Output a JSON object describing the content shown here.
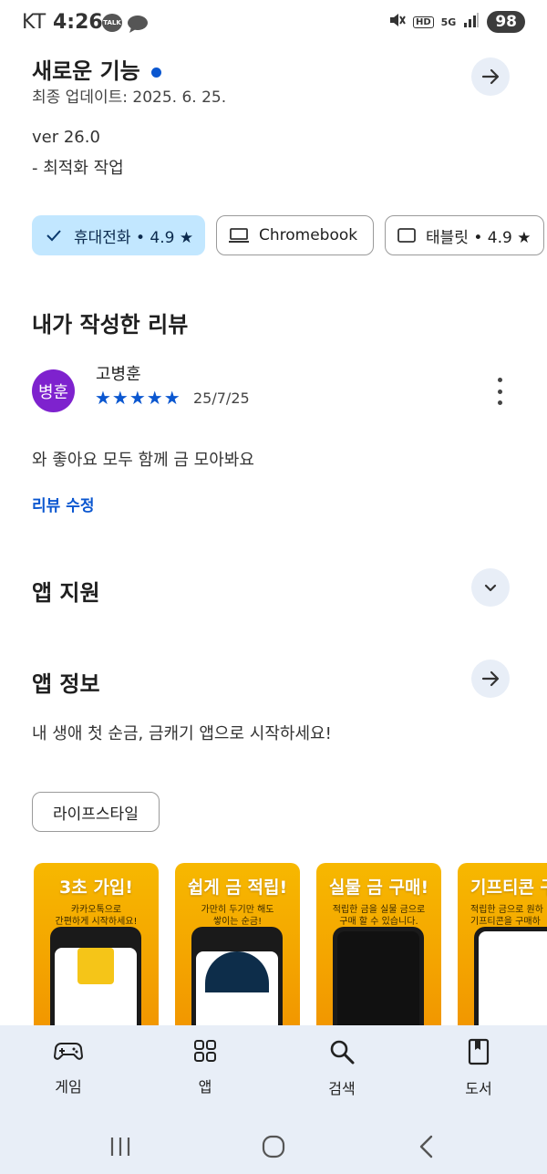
{
  "status": {
    "carrier": "KT",
    "time": "4:26",
    "battery": "98",
    "talk_badge": "TALK",
    "signal_label": "5G",
    "hd_label": "HD"
  },
  "whats_new": {
    "title": "새로운 기능",
    "updated": "최종 업데이트: 2025. 6. 25.",
    "version": "ver 26.0",
    "note": "- 최적화 작업"
  },
  "device_chips": [
    {
      "label": "휴대전화 • 4.9 ★",
      "icon": "check-icon"
    },
    {
      "label": "Chromebook",
      "icon": "laptop-icon"
    },
    {
      "label": "태블릿 • 4.9 ★",
      "icon": "tablet-icon"
    }
  ],
  "my_review": {
    "heading": "내가 작성한 리뷰",
    "avatar_text": "병훈",
    "avatar_color": "#7e22ce",
    "author": "고병훈",
    "stars": "★★★★★",
    "rating": 5,
    "date": "25/7/25",
    "text": "와 좋아요 모두 함께 금 모아봐요",
    "edit_label": "리뷰 수정"
  },
  "app_support": {
    "heading": "앱 지원"
  },
  "app_info": {
    "heading": "앱 정보",
    "description": "내 생애 첫 순금, 금캐기 앱으로 시작하세요!",
    "category_tag": "라이프스타일"
  },
  "screenshots": [
    {
      "title": "3초 가입!",
      "subtitle": "카카오톡으로\n간편하게 시작하세요!"
    },
    {
      "title": "쉽게 금 적립!",
      "subtitle": "가만히 두기만 해도\n쌓이는 순금!"
    },
    {
      "title": "실물 금 구매!",
      "subtitle": "적립한 금을 실물 금으로\n구매 할 수 있습니다."
    },
    {
      "title": "기프티콘 구",
      "subtitle": "적립한 금으로 원하\n기프티콘을 구매하"
    }
  ],
  "bottom_nav": [
    {
      "label": "게임",
      "icon": "gamepad-icon"
    },
    {
      "label": "앱",
      "icon": "apps-grid-icon"
    },
    {
      "label": "검색",
      "icon": "search-icon"
    },
    {
      "label": "도서",
      "icon": "book-icon"
    }
  ],
  "colors": {
    "accent": "#0b57d0",
    "chip_selected": "#c2e7ff",
    "nav_bg": "#e8eef7",
    "shot_bg": "#f5a400"
  }
}
